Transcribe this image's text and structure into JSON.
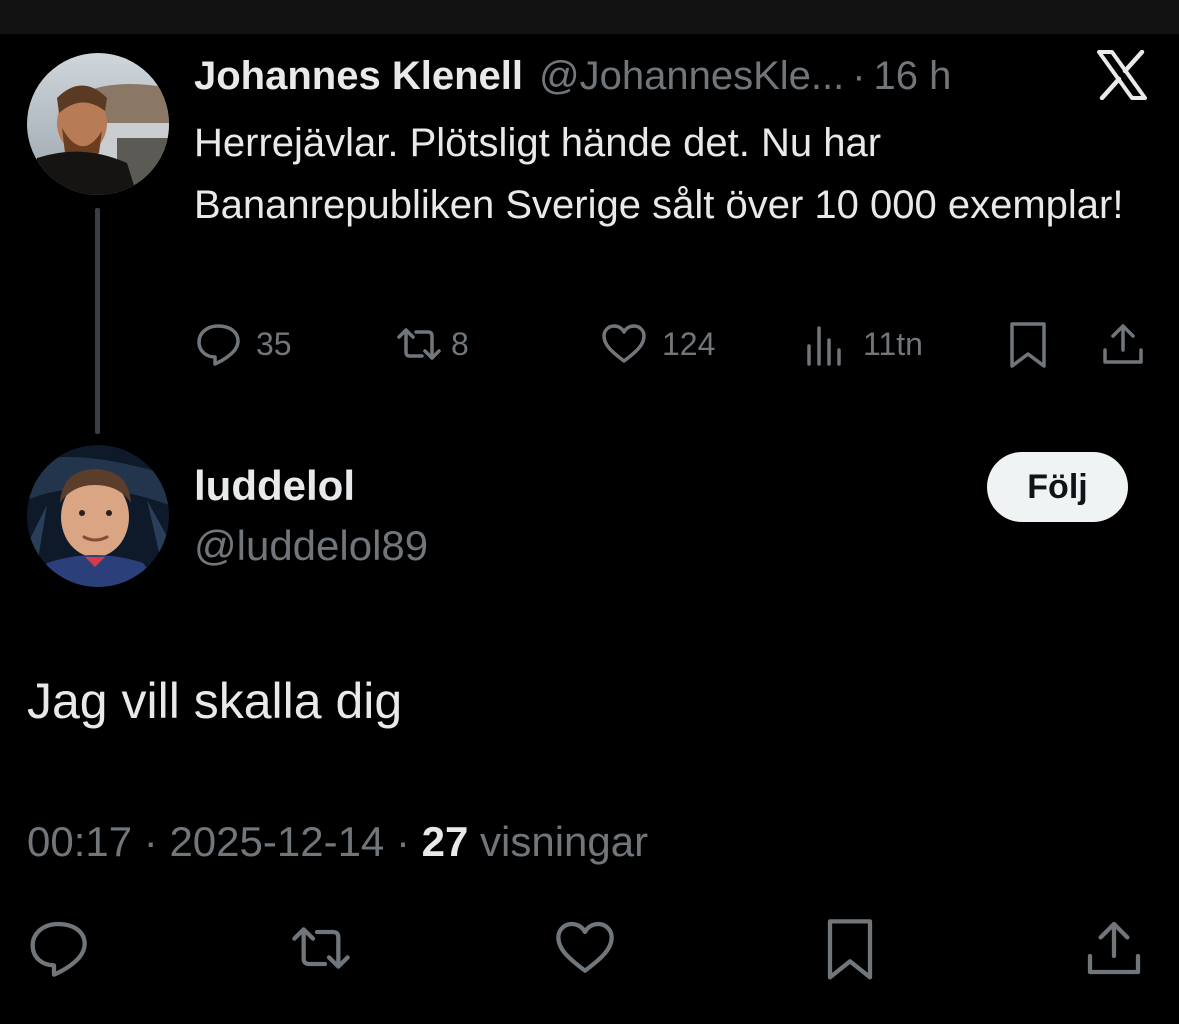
{
  "parent_tweet": {
    "author_name": "Johannes Klenell",
    "author_handle": "@JohannesKle...",
    "separator": "·",
    "time": "16 h",
    "text": "Herrejävlar. Plötsligt hände det. Nu har Bananrepubliken Sverige sålt över 10 000 exemplar!",
    "stats": {
      "replies": "35",
      "reposts": "8",
      "likes": "124",
      "views": "11tn"
    }
  },
  "reply_tweet": {
    "author_name": "luddelol",
    "author_handle": "@luddelol89",
    "follow_label": "Följ",
    "text": "Jag vill skalla dig",
    "time": "00:17",
    "separator": "·",
    "date": "2025-12-14",
    "views_count": "27",
    "views_label": "visningar"
  },
  "icons": {
    "reply": "reply-icon",
    "repost": "repost-icon",
    "like": "heart-icon",
    "views": "analytics-icon",
    "bookmark": "bookmark-icon",
    "share": "share-icon",
    "brand": "x-logo-icon"
  },
  "colors": {
    "background": "#000000",
    "text": "#e7e9ea",
    "muted": "#71767b",
    "follow_button": "#eff3f4"
  }
}
